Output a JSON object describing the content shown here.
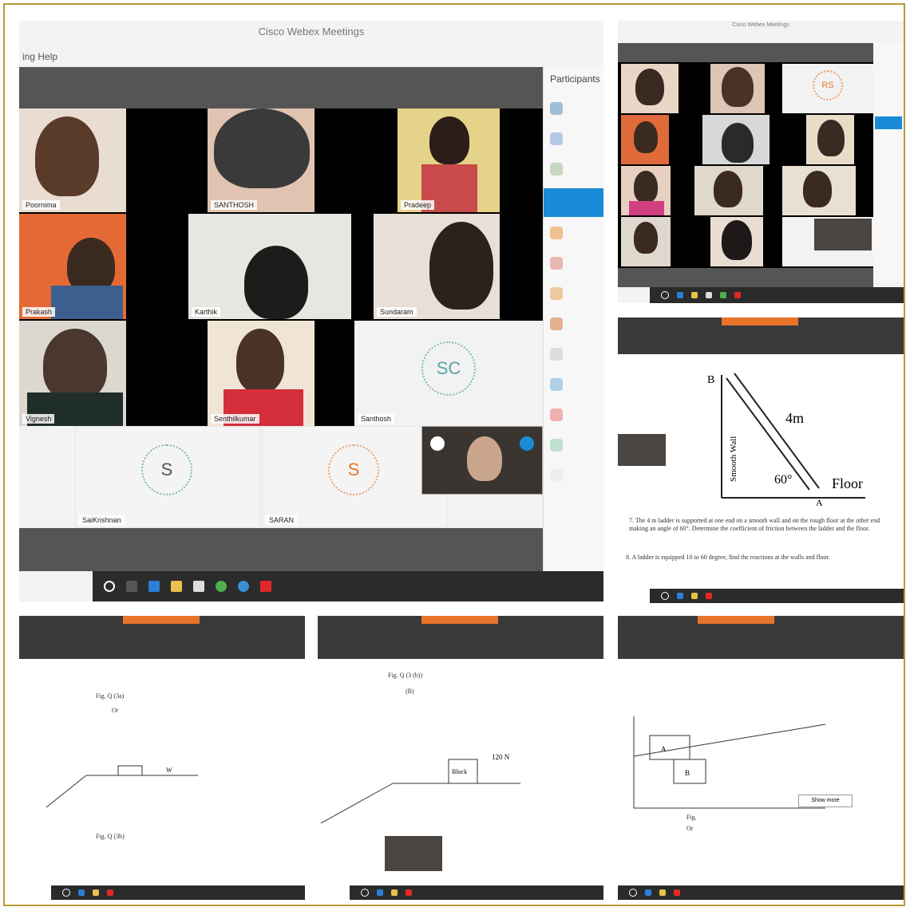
{
  "meeting": {
    "title": "Cisco Webex Meetings",
    "menu": "ing  Help",
    "sidebar_header": "Participants",
    "participants": [
      {
        "name": "Poornima"
      },
      {
        "name": "SANTHOSH"
      },
      {
        "name": "Pradeep"
      },
      {
        "name": "Prakash"
      },
      {
        "name": "Karthik"
      },
      {
        "name": "Sundaram"
      },
      {
        "name": "Vignesh"
      },
      {
        "name": "Senthilkumar"
      },
      {
        "name": "Santhosh"
      },
      {
        "name": "SaiKrishnan"
      },
      {
        "name": "SARAN"
      }
    ],
    "avatars": {
      "large": "SC",
      "s1": "S",
      "s2": "S"
    }
  },
  "small_meeting": {
    "title": "Cisco Webex Meetings",
    "avatar": "RS"
  },
  "diagram": {
    "label_wall": "Smooth Wall",
    "label_length": "4m",
    "label_angle": "60°",
    "label_floor": "Floor",
    "label_B": "B",
    "label_A": "A",
    "text_1": "7.  The 4 m ladder is supported at one end on a smooth wall and on the rough floor at the other end making an angle of 60°. Determine the coefficient of friction between the ladder and the floor.",
    "text_2": "8.  A ladder is equipped 10 to 60 degree, find the reactions at the walls and floor."
  },
  "doc_a": {
    "caption1": "Fig. Q (3a)",
    "caption2": "Or",
    "caption3": "Fig. Q (3b)",
    "label_weight": "W"
  },
  "doc_b": {
    "caption1": "Fig. Q (3 (b))",
    "caption2": "(B)",
    "label_block": "Block",
    "label_load": "120 N"
  },
  "doc_c": {
    "label1": "A",
    "label2": "B",
    "caption1": "Fig.",
    "caption2": "Or",
    "button": "Show more"
  }
}
